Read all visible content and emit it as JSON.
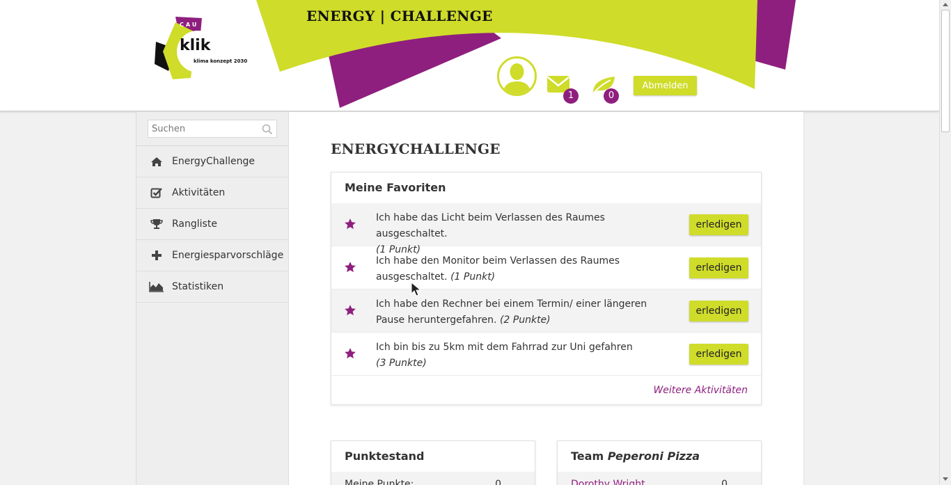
{
  "header": {
    "brand_title": "ENERGY | CHALLENGE",
    "logo": {
      "cau": "CAU",
      "name": "klik",
      "tagline": "klima konzept 2030"
    },
    "messages_count": "1",
    "leaves_count": "0",
    "logout_label": "Abmelden"
  },
  "colors": {
    "accent_lime": "#cfdc2a",
    "accent_purple": "#8e1f7e"
  },
  "sidebar": {
    "search_placeholder": "Suchen",
    "items": [
      {
        "label": "EnergyChallenge",
        "icon": "home-icon"
      },
      {
        "label": "Aktivitäten",
        "icon": "checkbox-icon"
      },
      {
        "label": "Rangliste",
        "icon": "trophy-icon"
      },
      {
        "label": "Energiesparvorschläge",
        "icon": "plus-icon"
      },
      {
        "label": "Statistiken",
        "icon": "area-chart-icon"
      }
    ]
  },
  "main": {
    "page_title": "ENERGYCHALLENGE",
    "favorites": {
      "title": "Meine Favoriten",
      "button_label": "erledigen",
      "items": [
        {
          "text": "Ich habe das Licht beim Verlassen des Raumes ausgeschaltet.",
          "points": "(1 Punkt)"
        },
        {
          "text": "Ich habe den Monitor beim Verlassen des Raumes ausgeschaltet.",
          "points": "(1 Punkt)"
        },
        {
          "text": "Ich habe den Rechner bei einem Termin/ einer längeren Pause heruntergefahren.",
          "points": "(2 Punkte)"
        },
        {
          "text": "Ich bin bis zu 5km mit dem Fahrrad zur Uni gefahren",
          "points": "(3 Punkte)"
        }
      ],
      "more_link": "Weitere Aktivitäten"
    },
    "points": {
      "title": "Punktestand",
      "row_label": "Meine Punkte:",
      "row_value": "0"
    },
    "team": {
      "title_prefix": "Team",
      "team_name": "Peperoni Pizza",
      "member": "Dorothy Wright",
      "member_value": "0"
    }
  }
}
